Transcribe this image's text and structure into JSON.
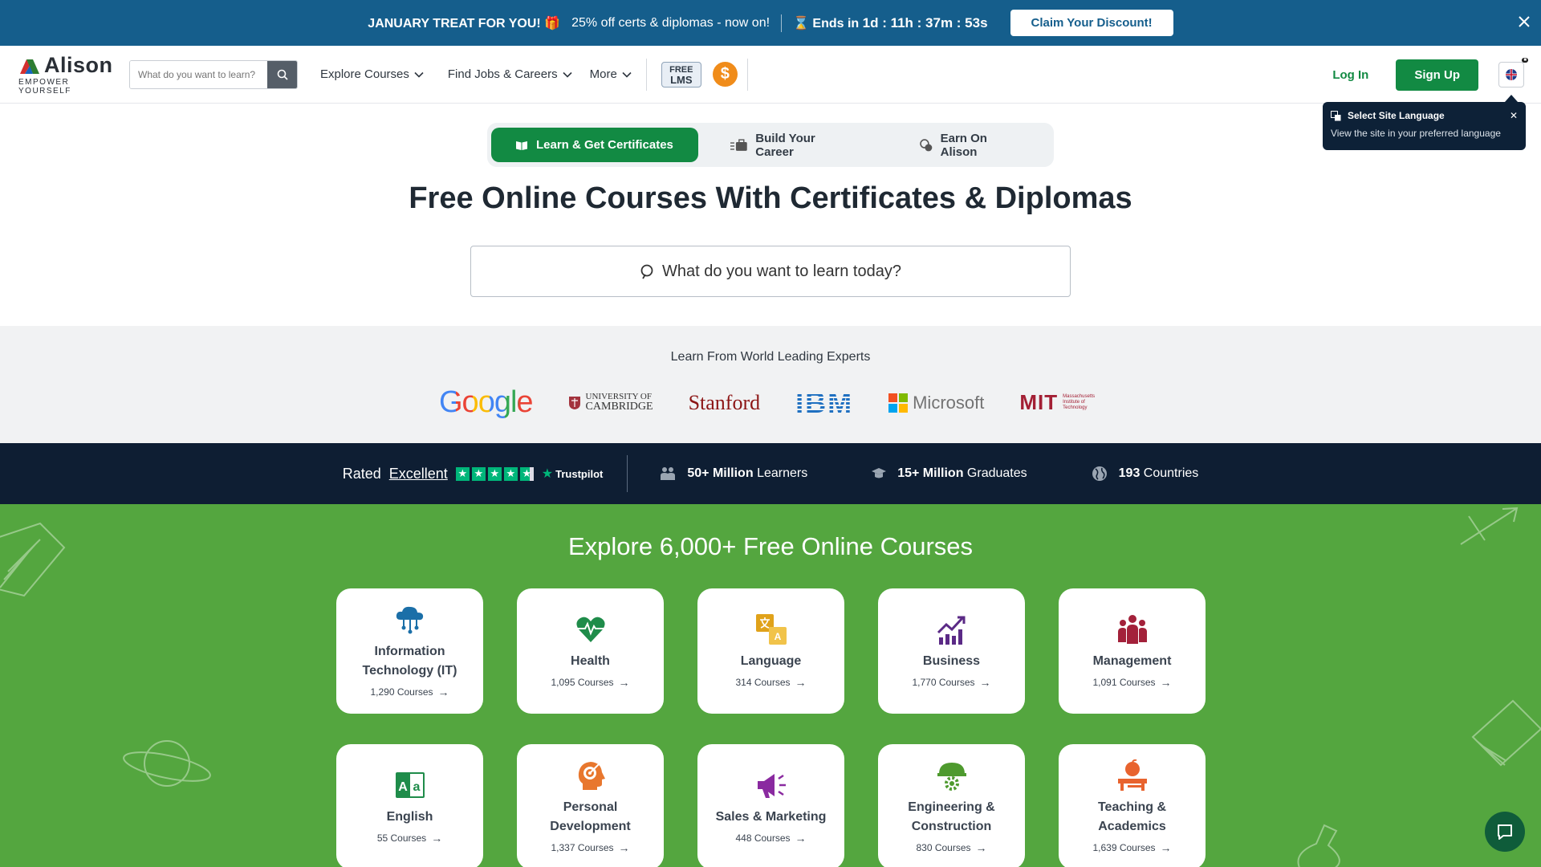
{
  "promo": {
    "treat": "JANUARY TREAT FOR YOU! 🎁",
    "offer": "25% off certs & diplomas - now on!",
    "ends_prefix": "Ends in",
    "countdown": "1d : 11h : 37m : 53s",
    "cta": "Claim Your Discount!"
  },
  "nav": {
    "logo_name": "Alison",
    "logo_tag": "EMPOWER YOURSELF",
    "search_placeholder": "What do you want to learn?",
    "menu": [
      "Explore Courses",
      "Find Jobs & Careers",
      "More"
    ],
    "lms_line1": "FREE",
    "lms_line2": "LMS",
    "coin": "$",
    "login": "Log In",
    "signup": "Sign Up"
  },
  "lang_popup": {
    "title": "Select Site Language",
    "subtitle": "View the site in your preferred language"
  },
  "tabs": [
    "Learn & Get Certificates",
    "Build Your Career",
    "Earn On Alison"
  ],
  "hero": {
    "title": "Free Online Courses With Certificates & Diplomas",
    "search": "What do you want to learn today?"
  },
  "partners": {
    "title": "Learn From World Leading Experts",
    "google": "Google",
    "cambridge_l1": "UNIVERSITY OF",
    "cambridge_l2": "CAMBRIDGE",
    "stanford": "Stanford",
    "ibm": "IBM",
    "microsoft": "Microsoft",
    "mit": "MIT",
    "mit_small": "Massachusetts Institute of Technology"
  },
  "stats": {
    "rated": "Rated",
    "excellent": "Excellent",
    "trustpilot": "Trustpilot",
    "learners_num": "50+ Million",
    "learners_lbl": "Learners",
    "grads_num": "15+ Million",
    "grads_lbl": "Graduates",
    "countries_num": "193",
    "countries_lbl": "Countries"
  },
  "explore": {
    "title": "Explore 6,000+ Free Online Courses",
    "categories": [
      {
        "name": "Information Technology (IT)",
        "count": "1,290 Courses",
        "icon": "cloud-network-icon",
        "color": "#1b6fa8"
      },
      {
        "name": "Health",
        "count": "1,095 Courses",
        "icon": "heart-pulse-icon",
        "color": "#1f8c4a"
      },
      {
        "name": "Language",
        "count": "314 Courses",
        "icon": "translate-icon",
        "color": "#e0a21a"
      },
      {
        "name": "Business",
        "count": "1,770 Courses",
        "icon": "growth-chart-icon",
        "color": "#5b2a86"
      },
      {
        "name": "Management",
        "count": "1,091 Courses",
        "icon": "team-icon",
        "color": "#a3213a"
      },
      {
        "name": "English",
        "count": "55 Courses",
        "icon": "english-book-icon",
        "color": "#1f8c4a"
      },
      {
        "name": "Personal Development",
        "count": "1,337 Courses",
        "icon": "head-target-icon",
        "color": "#e8772e"
      },
      {
        "name": "Sales & Marketing",
        "count": "448 Courses",
        "icon": "megaphone-icon",
        "color": "#8a2aa0"
      },
      {
        "name": "Engineering & Construction",
        "count": "830 Courses",
        "icon": "hardhat-gear-icon",
        "color": "#4e9a2e"
      },
      {
        "name": "Teaching & Academics",
        "count": "1,639 Courses",
        "icon": "apple-desk-icon",
        "color": "#e8632e"
      }
    ]
  }
}
